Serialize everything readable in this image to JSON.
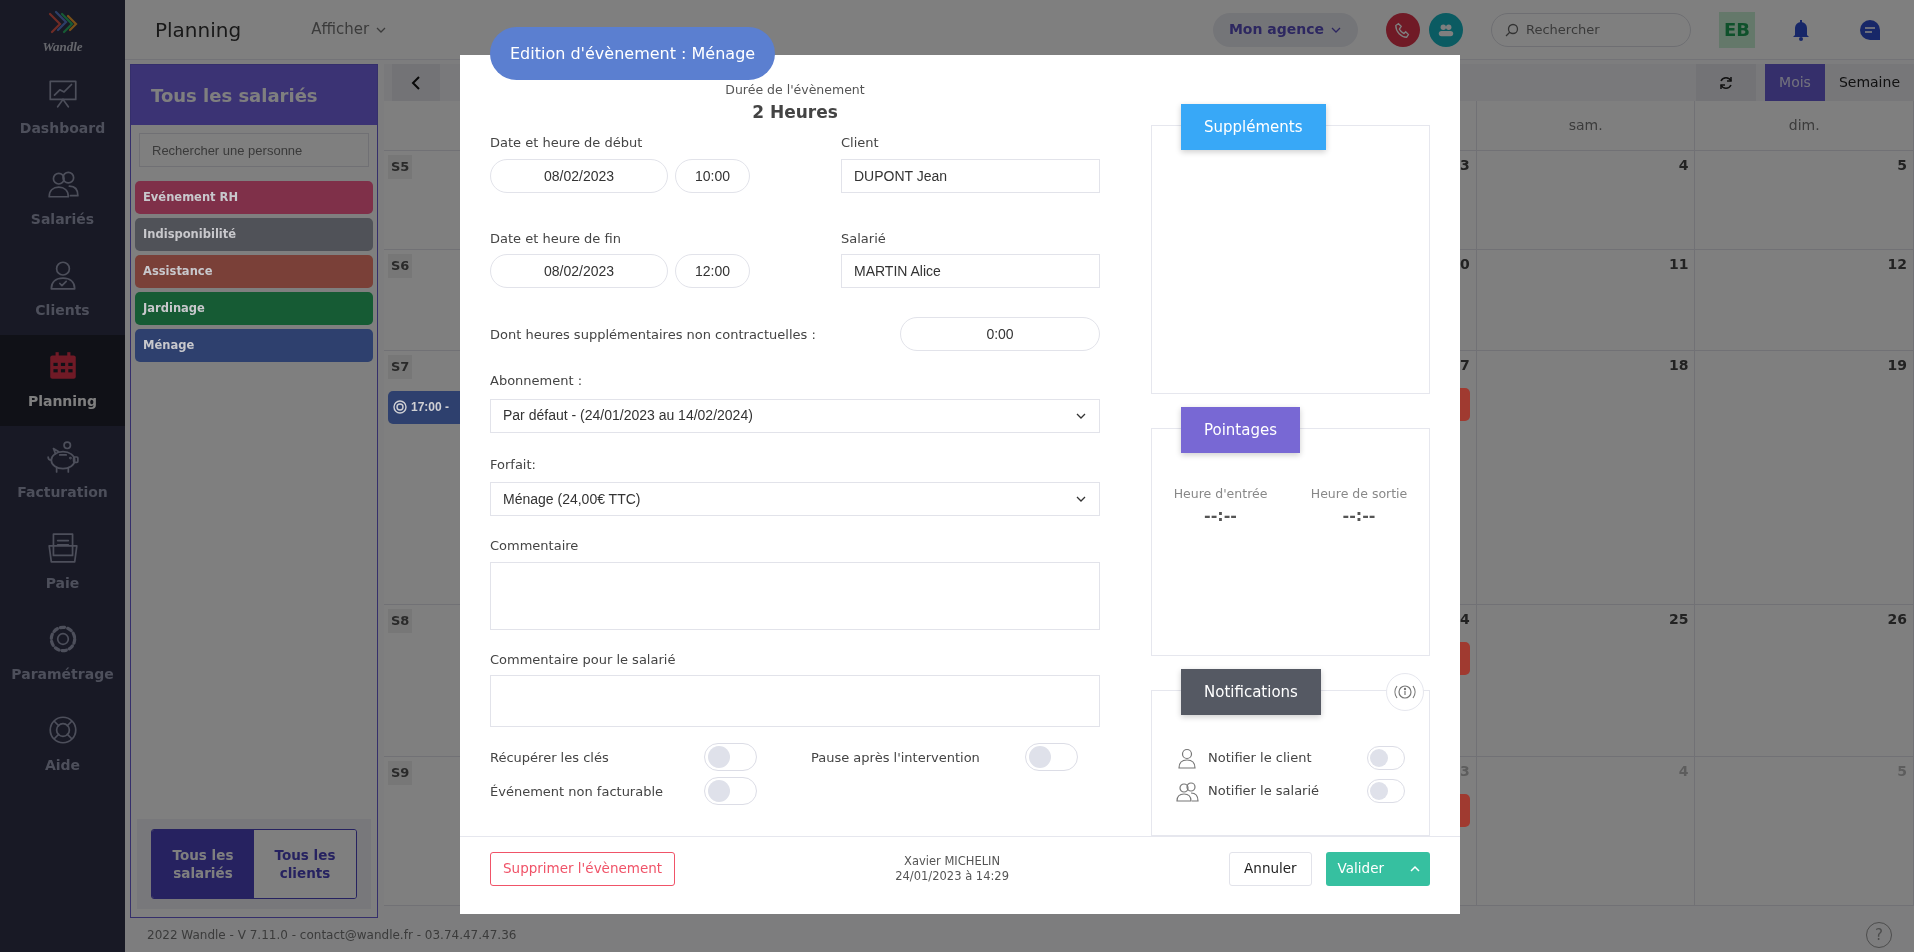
{
  "logo": {
    "text": "Wandle"
  },
  "nav": [
    {
      "label": "Dashboard",
      "kind": "chart",
      "selected": false
    },
    {
      "label": "Salariés",
      "kind": "people",
      "selected": false
    },
    {
      "label": "Clients",
      "kind": "person",
      "selected": false
    },
    {
      "label": "Planning",
      "kind": "calendar",
      "selected": true
    },
    {
      "label": "Facturation",
      "kind": "piggy",
      "selected": false
    },
    {
      "label": "Paie",
      "kind": "folder",
      "selected": false
    },
    {
      "label": "Paramétrage",
      "kind": "gear",
      "selected": false
    },
    {
      "label": "Aide",
      "kind": "lifebuoy",
      "selected": false
    }
  ],
  "topbar": {
    "title": "Planning",
    "view_menu": "Afficher",
    "agency_menu": "Mon agence",
    "search": {
      "placeholder": "Rechercher"
    },
    "avatar": "EB"
  },
  "people_panel": {
    "title": "Tous les salariés",
    "search": {
      "placeholder": "Rechercher une personne"
    },
    "categories": [
      {
        "label": "Evénement RH",
        "color": "#7f3049"
      },
      {
        "label": "Indisponibilité",
        "color": "#505258"
      },
      {
        "label": "Assistance",
        "color": "#7a4038"
      },
      {
        "label": "Jardinage",
        "color": "#165b34"
      },
      {
        "label": "Ménage",
        "color": "#2e406e"
      }
    ],
    "switch": [
      {
        "label": "Tous les salariés",
        "selected": true
      },
      {
        "label": "Tous les clients",
        "selected": false
      }
    ]
  },
  "calendar": {
    "views": [
      {
        "label": "Mois",
        "selected": true
      },
      {
        "label": "Semaine",
        "selected": false
      }
    ],
    "day_headers": [
      "sam.",
      "dim."
    ],
    "weeks": [
      {
        "label": "S5",
        "days": [
          {
            "number": "3",
            "other_month": false
          },
          {
            "number": "4",
            "other_month": false
          },
          {
            "number": "5",
            "other_month": false
          }
        ]
      },
      {
        "label": "S6",
        "days": [
          {
            "number": "0",
            "other_month": false
          },
          {
            "number": "11",
            "other_month": false
          },
          {
            "number": "12",
            "other_month": false
          }
        ]
      },
      {
        "label": "S7",
        "monday_events": [
          {
            "time": "17:00 -",
            "color": "#2e406e"
          }
        ],
        "days": [
          {
            "number": "7",
            "other_month": false,
            "events": [
              {
                "color": "#a03a30"
              }
            ]
          },
          {
            "number": "18",
            "other_month": false
          },
          {
            "number": "19",
            "other_month": false
          }
        ]
      },
      {
        "label": "S8",
        "days": [
          {
            "number": "4",
            "other_month": false,
            "events": [
              {
                "color": "#a03a30"
              }
            ]
          },
          {
            "number": "25",
            "other_month": false
          },
          {
            "number": "26",
            "other_month": false
          }
        ]
      },
      {
        "label": "S9",
        "days": [
          {
            "number": "3",
            "other_month": true,
            "events": [
              {
                "color": "#a03a30"
              }
            ]
          },
          {
            "number": "4",
            "other_month": true
          },
          {
            "number": "5",
            "other_month": true
          }
        ]
      }
    ]
  },
  "footer": "2022 Wandle - V 7.11.0 - contact@wandle.fr - 03.74.47.47.36",
  "help": "?",
  "modal": {
    "title": "Edition d'évènement : Ménage",
    "duration": {
      "label": "Durée de l'évènement",
      "value": "2 Heures"
    },
    "start": {
      "label": "Date et heure de début",
      "date": "08/02/2023",
      "time": "10:00"
    },
    "client": {
      "label": "Client",
      "value": "DUPONT Jean"
    },
    "end": {
      "label": "Date et heure de fin",
      "date": "08/02/2023",
      "time": "12:00"
    },
    "employee": {
      "label": "Salarié",
      "value": "MARTIN Alice"
    },
    "overtime": {
      "label": "Dont heures supplémentaires non contractuelles :",
      "value": "0:00"
    },
    "subscription": {
      "label": "Abonnement :",
      "value": "Par défaut - (24/01/2023 au 14/02/2024)"
    },
    "package": {
      "label": "Forfait:",
      "value": "Ménage (24,00€ TTC)"
    },
    "comment": {
      "label": "Commentaire"
    },
    "employee_comment": {
      "label": "Commentaire pour le salarié"
    },
    "toggles": [
      {
        "label": "Récupérer les clés",
        "on": false
      },
      {
        "label": "Pause après l'intervention",
        "on": false
      },
      {
        "label": "Événement non facturable",
        "on": false
      }
    ],
    "supplements": {
      "title": "Suppléments"
    },
    "clock_ins": {
      "title": "Pointages",
      "columns": [
        {
          "label": "Heure d'entrée",
          "value": "--:--"
        },
        {
          "label": "Heure de sortie",
          "value": "--:--"
        }
      ]
    },
    "notifications": {
      "title": "Notifications",
      "items": [
        {
          "kind": "client",
          "label": "Notifier le client",
          "on": false
        },
        {
          "kind": "employee",
          "label": "Notifier le salarié",
          "on": false
        }
      ]
    },
    "delete_button": "Supprimer l'évènement",
    "author": {
      "name": "Xavier MICHELIN",
      "date": "24/01/2023 à 14:29"
    },
    "cancel_button": "Annuler",
    "submit_button": "Valider"
  }
}
